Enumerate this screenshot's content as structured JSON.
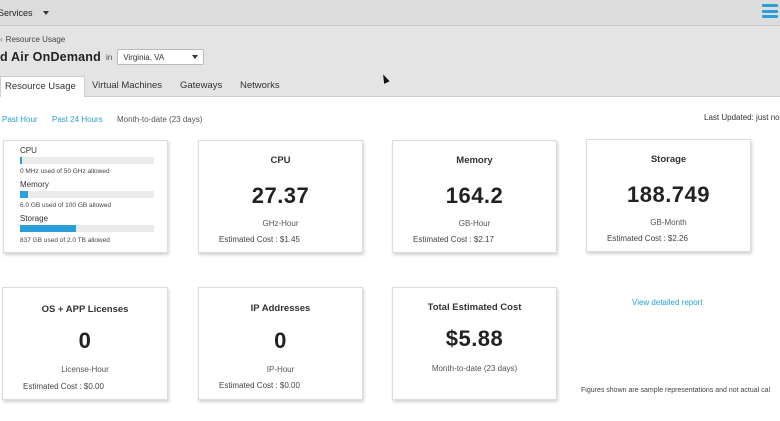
{
  "topbar": {
    "services_label": "Services",
    "menu_icon": "hamburger-menu-icon",
    "accent": "#2b9fd9"
  },
  "breadcrumb": {
    "label": "Resource Usage"
  },
  "header": {
    "title": "d Air OnDemand",
    "in_label": "in",
    "region": "Virginia, VA"
  },
  "tabs": [
    {
      "label": "Resource Usage",
      "active": true
    },
    {
      "label": "Virtual Machines",
      "active": false
    },
    {
      "label": "Gateways",
      "active": false
    },
    {
      "label": "Networks",
      "active": false
    }
  ],
  "time_ranges": [
    {
      "label": "Past Hour",
      "link": true
    },
    {
      "label": "Past 24 Hours",
      "link": true
    },
    {
      "label": "Month-to-date (23 days)",
      "link": false
    }
  ],
  "last_updated": "Last Updated: just no",
  "usage_summary": [
    {
      "label": "CPU",
      "note": "0 MHz used of 50 GHz allowed",
      "fraction": 0.0
    },
    {
      "label": "Memory",
      "note": "6.0 GB used of 100 GB allowed",
      "fraction": 0.06
    },
    {
      "label": "Storage",
      "note": "837 GB used of 2.0 TB allowed",
      "fraction": 0.4185
    }
  ],
  "cards": {
    "cpu": {
      "title": "CPU",
      "value": "27.37",
      "unit": "GHz-Hour",
      "cost": "Estimated Cost : $1.45"
    },
    "memory": {
      "title": "Memory",
      "value": "164.2",
      "unit": "GB-Hour",
      "cost": "Estimated Cost : $2.17"
    },
    "storage": {
      "title": "Storage",
      "value": "188.749",
      "unit": "GB-Month",
      "cost": "Estimated Cost : $2.26"
    },
    "licenses": {
      "title": "OS + APP Licenses",
      "value": "0",
      "unit": "License-Hour",
      "cost": "Estimated Cost : $0.00"
    },
    "ip": {
      "title": "IP Addresses",
      "value": "0",
      "unit": "IP-Hour",
      "cost": "Estimated Cost : $0.00"
    },
    "total": {
      "title": "Total Estimated Cost",
      "value": "$5.88",
      "unit": "Month-to-date (23 days)"
    }
  },
  "view_report": "View detailed report",
  "footnote": "Figures shown are sample representations and not actual cal"
}
